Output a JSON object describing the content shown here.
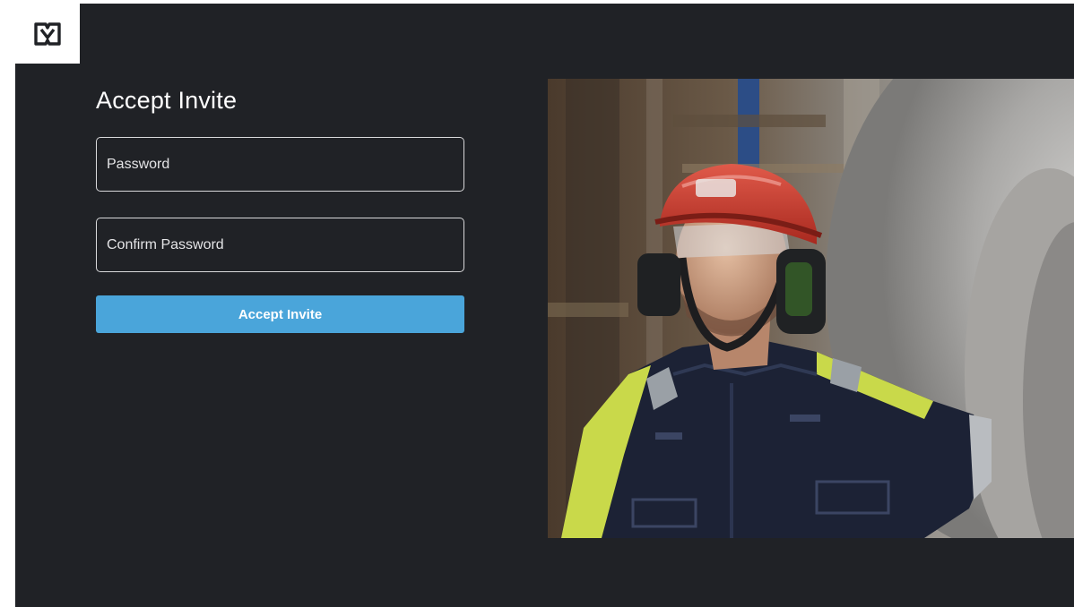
{
  "brand": {
    "logo_icon": "brand-m-logo-icon"
  },
  "form": {
    "title": "Accept Invite",
    "password_placeholder": "Password",
    "confirm_password_placeholder": "Confirm Password",
    "submit_label": "Accept Invite"
  },
  "hero": {
    "image_icon": "worker-with-hardhat-and-smart-glasses-photo"
  },
  "colors": {
    "background": "#202226",
    "accent": "#4aa5da",
    "field_border": "#d9d9db",
    "text": "#ffffff"
  }
}
